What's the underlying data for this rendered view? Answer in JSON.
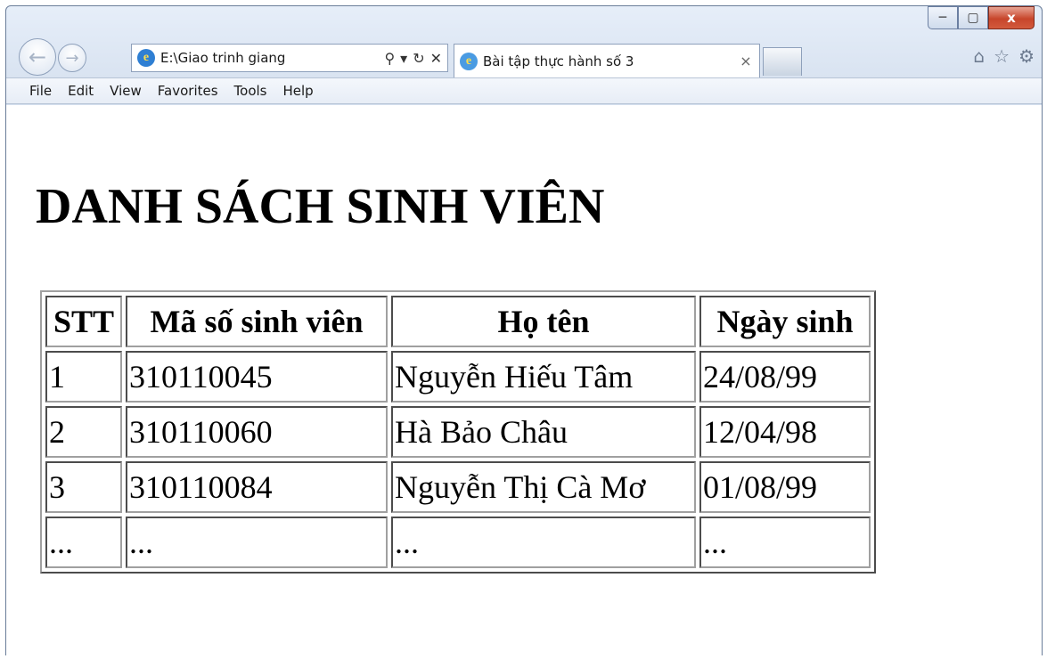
{
  "window": {
    "controls": {
      "minimize": "─",
      "maximize": "▢",
      "close": "x"
    }
  },
  "nav": {
    "back_glyph": "←",
    "forward_glyph": "→",
    "address_url": "E:\\Giao trinh giang",
    "search_glyph": "⚲",
    "dropdown_glyph": "▾",
    "refresh_glyph": "↻",
    "stop_glyph": "✕"
  },
  "tab": {
    "title": "Bài tập thực hành số 3",
    "close_glyph": "×"
  },
  "toolbar_icons": {
    "home": "⌂",
    "favorites": "☆",
    "tools": "⚙"
  },
  "menu": {
    "items": [
      "File",
      "Edit",
      "View",
      "Favorites",
      "Tools",
      "Help"
    ]
  },
  "page": {
    "title": "DANH SÁCH SINH VIÊN",
    "table": {
      "headers": [
        "STT",
        "Mã số sinh viên",
        "Họ tên",
        "Ngày sinh"
      ],
      "rows": [
        [
          "1",
          "310110045",
          "Nguyễn Hiếu Tâm",
          "24/08/99"
        ],
        [
          "2",
          "310110060",
          "Hà Bảo Châu",
          "12/04/98"
        ],
        [
          "3",
          "310110084",
          "Nguyễn Thị Cà Mơ",
          "01/08/99"
        ],
        [
          "...",
          "...",
          "...",
          "..."
        ]
      ]
    }
  }
}
